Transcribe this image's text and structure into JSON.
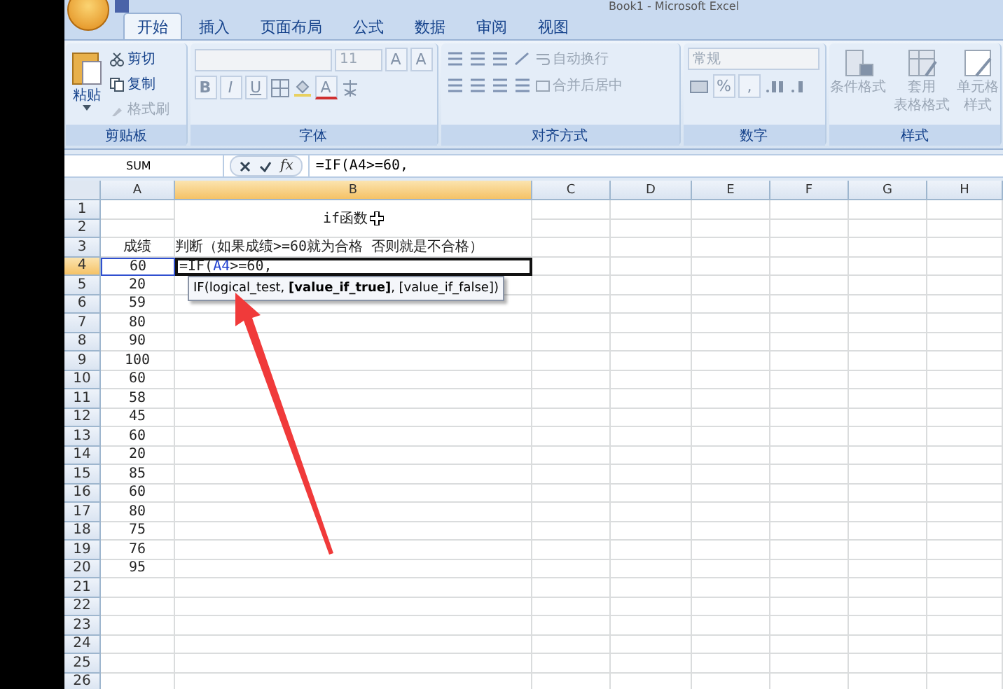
{
  "window": {
    "title": "Book1 - Microsoft Excel"
  },
  "tabs": [
    {
      "label": "开始",
      "selected": true
    },
    {
      "label": "插入",
      "selected": false
    },
    {
      "label": "页面布局",
      "selected": false
    },
    {
      "label": "公式",
      "selected": false
    },
    {
      "label": "数据",
      "selected": false
    },
    {
      "label": "审阅",
      "selected": false
    },
    {
      "label": "视图",
      "selected": false
    }
  ],
  "ribbon": {
    "clipboard": {
      "label": "剪贴板",
      "paste": "粘贴",
      "tools": [
        {
          "kind": "cut",
          "label": "剪切",
          "disabled": false
        },
        {
          "kind": "copy",
          "label": "复制",
          "disabled": false
        },
        {
          "kind": "painter",
          "label": "格式刷",
          "disabled": true
        }
      ]
    },
    "font": {
      "label": "字体",
      "size": "11",
      "grow": "A",
      "shrink": "A",
      "bold": "B",
      "italic": "I",
      "underline": "U",
      "font_color": "A"
    },
    "alignment": {
      "label": "对齐方式",
      "wrap": "自动换行",
      "merge": "合并后居中"
    },
    "number": {
      "label": "数字",
      "format": "常规",
      "percent": "%",
      "comma": ","
    },
    "styles": {
      "label": "样式",
      "buttons": [
        {
          "kind": "conditional",
          "lines": [
            "条件格式"
          ]
        },
        {
          "kind": "table",
          "lines": [
            "套用",
            "表格格式"
          ]
        },
        {
          "kind": "cell",
          "lines": [
            "单元格",
            "样式"
          ]
        }
      ]
    }
  },
  "formula_bar": {
    "name_box": "SUM",
    "fx": "fx",
    "formula": "=IF(A4>=60,"
  },
  "columns": [
    {
      "label": "A",
      "selected": false
    },
    {
      "label": "B",
      "selected": true
    },
    {
      "label": "C",
      "selected": false
    },
    {
      "label": "D",
      "selected": false
    },
    {
      "label": "E",
      "selected": false
    },
    {
      "label": "F",
      "selected": false
    },
    {
      "label": "G",
      "selected": false
    },
    {
      "label": "H",
      "selected": false
    }
  ],
  "rows": [
    {
      "number": "1",
      "selected": false,
      "col_b": {
        "text": "if函数",
        "merged_below": true
      }
    },
    {
      "number": "2",
      "selected": false
    },
    {
      "number": "3",
      "selected": false,
      "col_a": {
        "text": "成绩"
      },
      "col_b": {
        "text": "判断（如果成绩>=60就为合格  否则就是不合格）"
      }
    },
    {
      "number": "4",
      "selected": true,
      "col_a": {
        "text": "60",
        "referenced": true
      },
      "col_b": {
        "parts": [
          {
            "kind": "text",
            "text": "=IF("
          },
          {
            "kind": "reference",
            "text": "A4"
          },
          {
            "kind": "text",
            "text": ">=60,"
          }
        ]
      }
    },
    {
      "number": "5",
      "selected": false,
      "col_a": {
        "text": "20"
      }
    },
    {
      "number": "6",
      "selected": false,
      "col_a": {
        "text": "59"
      }
    },
    {
      "number": "7",
      "selected": false,
      "col_a": {
        "text": "80"
      }
    },
    {
      "number": "8",
      "selected": false,
      "col_a": {
        "text": "90"
      }
    },
    {
      "number": "9",
      "selected": false,
      "col_a": {
        "text": "100"
      }
    },
    {
      "number": "10",
      "selected": false,
      "col_a": {
        "text": "60"
      }
    },
    {
      "number": "11",
      "selected": false,
      "col_a": {
        "text": "58"
      }
    },
    {
      "number": "12",
      "selected": false,
      "col_a": {
        "text": "45"
      }
    },
    {
      "number": "13",
      "selected": false,
      "col_a": {
        "text": "60"
      }
    },
    {
      "number": "14",
      "selected": false,
      "col_a": {
        "text": "20"
      }
    },
    {
      "number": "15",
      "selected": false,
      "col_a": {
        "text": "85"
      }
    },
    {
      "number": "16",
      "selected": false,
      "col_a": {
        "text": "60"
      }
    },
    {
      "number": "17",
      "selected": false,
      "col_a": {
        "text": "80"
      }
    },
    {
      "number": "18",
      "selected": false,
      "col_a": {
        "text": "75"
      }
    },
    {
      "number": "19",
      "selected": false,
      "col_a": {
        "text": "76"
      }
    },
    {
      "number": "20",
      "selected": false,
      "col_a": {
        "text": "95"
      }
    },
    {
      "number": "21",
      "selected": false
    },
    {
      "number": "22",
      "selected": false
    },
    {
      "number": "23",
      "selected": false
    },
    {
      "number": "24",
      "selected": false
    },
    {
      "number": "25",
      "selected": false
    },
    {
      "number": "26",
      "selected": false
    }
  ],
  "tooltip": "IF(logical_test, **[value_if_true]**, [value_if_false])"
}
